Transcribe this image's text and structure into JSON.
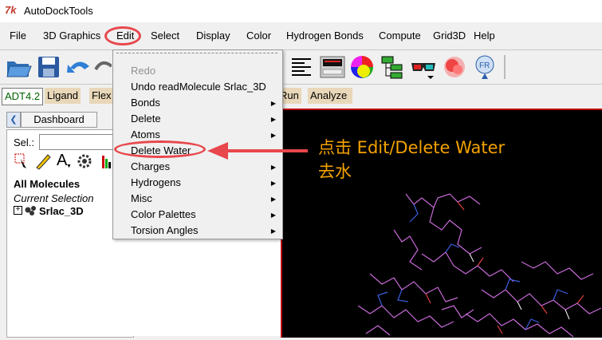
{
  "window": {
    "title": "AutoDockTools",
    "app_icon_text": "7k"
  },
  "menubar": {
    "items": [
      "File",
      "3D Graphics",
      "Edit",
      "Select",
      "Display",
      "Color",
      "Hydrogen Bonds",
      "Compute",
      "Grid3D",
      "Help"
    ]
  },
  "toolbar": {
    "icons": [
      "open-folder-icon",
      "save-icon",
      "undo-icon",
      "redo-icon",
      "text-list-icon",
      "display-panel-icon",
      "color-wheel-icon",
      "sphere-icon",
      "molecule-hierarchy-icon",
      "3d-glasses-icon",
      "surface-icon",
      "fr-icon"
    ]
  },
  "tabs": {
    "items": [
      "ADT4.2",
      "Ligand",
      "Flex",
      "Run",
      "Analyze"
    ]
  },
  "dashboard": {
    "button_label": "Dashboard",
    "sel_label": "Sel.:",
    "sel_value": "",
    "a_label": "A"
  },
  "tree": {
    "header": "All Molecules",
    "current_selection": "Current Selection",
    "molecule": "Srlac_3D"
  },
  "edit_menu": {
    "items": [
      {
        "label": "Redo",
        "disabled": true,
        "submenu": false
      },
      {
        "label": "Undo readMolecule Srlac_3D",
        "disabled": false,
        "submenu": false
      },
      {
        "label": "Bonds",
        "disabled": false,
        "submenu": true
      },
      {
        "label": "Delete",
        "disabled": false,
        "submenu": true
      },
      {
        "label": "Atoms",
        "disabled": false,
        "submenu": true
      },
      {
        "label": "Delete Water",
        "disabled": false,
        "submenu": false
      },
      {
        "label": "Charges",
        "disabled": false,
        "submenu": true
      },
      {
        "label": "Hydrogens",
        "disabled": false,
        "submenu": true
      },
      {
        "label": "Misc",
        "disabled": false,
        "submenu": true
      },
      {
        "label": "Color Palettes",
        "disabled": false,
        "submenu": true
      },
      {
        "label": "Torsion Angles",
        "disabled": false,
        "submenu": true
      }
    ]
  },
  "annotation": {
    "line1": "点击 Edit/Delete Water",
    "line2": "去水",
    "color": "#f4a200",
    "highlight_color": "#e8474c"
  }
}
